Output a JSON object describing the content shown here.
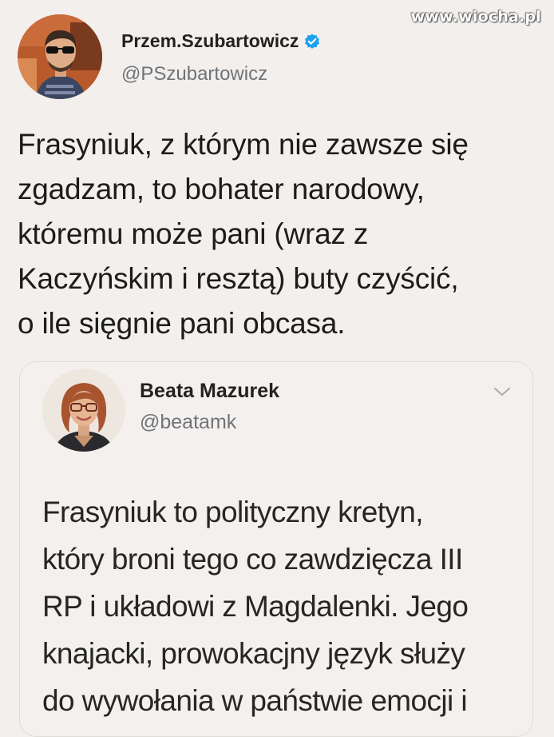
{
  "watermark": "www.wiocha.pl",
  "tweet": {
    "display_name": "Przem.Szubartowicz",
    "handle": "@PSzubartowicz",
    "verified": true,
    "text": "Frasyniuk, z którym nie zawsze się\nzgadzam, to bohater narodowy,\nktóremu może pani (wraz z\nKaczyńskim i resztą) buty czyścić,\no ile sięgnie pani obcasa."
  },
  "quoted_tweet": {
    "display_name": "Beata Mazurek",
    "handle": "@beatamk",
    "text": "Frasyniuk to polityczny kretyn,\nktóry broni tego co zawdzięcza III\nRP i układowi z Magdalenki. Jego\nknajacki, prowokacjny język służy\ndo wywołania w państwie emocji i"
  },
  "colors": {
    "background": "#f2efec",
    "verified_blue": "#1da1f2",
    "handle_gray": "#6f7479",
    "text": "#1c1c1c"
  },
  "icons": [
    "verified-badge-icon",
    "chevron-down-icon"
  ]
}
